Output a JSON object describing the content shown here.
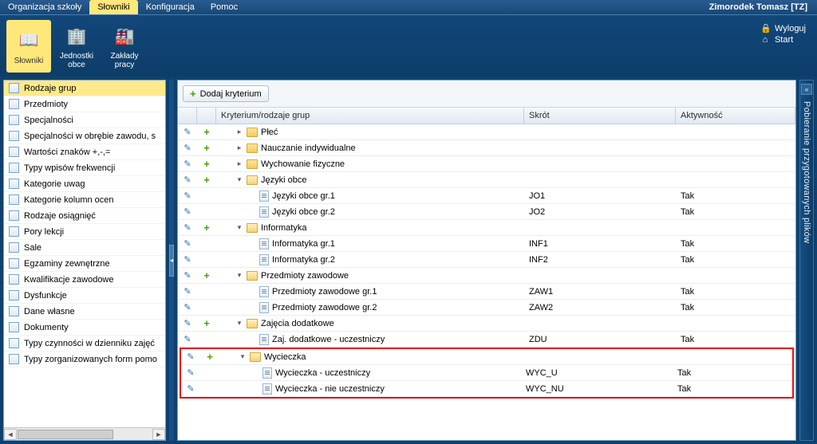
{
  "topbar": {
    "tabs": [
      "Organizacja szkoły",
      "Słowniki",
      "Konfiguracja",
      "Pomoc"
    ],
    "activeTab": 1,
    "user": "Zimorodek Tomasz [TZ]"
  },
  "ribbon": {
    "buttons": [
      {
        "label": "Słowniki",
        "active": true
      },
      {
        "label": "Jednostki obce",
        "active": false
      },
      {
        "label": "Zakłady pracy",
        "active": false
      }
    ],
    "links": {
      "logout": "Wyloguj",
      "start": "Start"
    }
  },
  "sidebar": {
    "items": [
      "Rodzaje grup",
      "Przedmioty",
      "Specjalności",
      "Specjalności w obrębie zawodu, s",
      "Wartości znaków +,-,=",
      "Typy wpisów frekwencji",
      "Kategorie uwag",
      "Kategorie kolumn ocen",
      "Rodzaje osiągnięć",
      "Pory lekcji",
      "Sale",
      "Egzaminy zewnętrzne",
      "Kwalifikacje zawodowe",
      "Dysfunkcje",
      "Dane własne",
      "Dokumenty",
      "Typy czynności w dzienniku zajęć",
      "Typy zorganizowanych form pomo"
    ],
    "activeIndex": 0
  },
  "toolbar": {
    "add_criterion": "Dodaj kryterium"
  },
  "grid": {
    "headers": {
      "criterion": "Kryterium/rodzaje grup",
      "short": "Skrót",
      "activity": "Aktywność"
    },
    "activityYes": "Tak",
    "rows": [
      {
        "type": "group",
        "open": false,
        "label": "Płeć"
      },
      {
        "type": "group",
        "open": false,
        "label": "Nauczanie indywidualne"
      },
      {
        "type": "group",
        "open": false,
        "label": "Wychowanie fizyczne"
      },
      {
        "type": "group",
        "open": true,
        "label": "Języki obce"
      },
      {
        "type": "item",
        "label": "Języki obce gr.1",
        "short": "JO1"
      },
      {
        "type": "item",
        "label": "Języki obce gr.2",
        "short": "JO2"
      },
      {
        "type": "group",
        "open": true,
        "label": "Informatyka"
      },
      {
        "type": "item",
        "label": "Informatyka gr.1",
        "short": "INF1"
      },
      {
        "type": "item",
        "label": "Informatyka gr.2",
        "short": "INF2"
      },
      {
        "type": "group",
        "open": true,
        "label": "Przedmioty zawodowe"
      },
      {
        "type": "item",
        "label": "Przedmioty zawodowe gr.1",
        "short": "ZAW1"
      },
      {
        "type": "item",
        "label": "Przedmioty zawodowe gr.2",
        "short": "ZAW2"
      },
      {
        "type": "group",
        "open": true,
        "label": "Zajęcia dodatkowe"
      },
      {
        "type": "item",
        "label": "Zaj. dodatkowe - uczestniczy",
        "short": "ZDU"
      }
    ],
    "highlightRows": [
      {
        "type": "group",
        "open": true,
        "label": "Wycieczka"
      },
      {
        "type": "item",
        "label": "Wycieczka - uczestniczy",
        "short": "WYC_U"
      },
      {
        "type": "item",
        "label": "Wycieczka - nie uczestniczy",
        "short": "WYC_NU"
      }
    ]
  },
  "rightDock": {
    "label": "Pobieranie przygotowanych plików"
  }
}
